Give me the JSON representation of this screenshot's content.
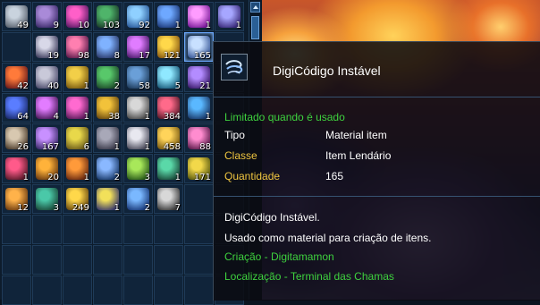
{
  "inventory": {
    "slots": [
      {
        "qty": "49",
        "c1": "#c9d3de",
        "c2": "#59626e"
      },
      {
        "qty": "9",
        "c1": "#a98ad8",
        "c2": "#3b2a6a"
      },
      {
        "qty": "10",
        "c1": "#ff5fc8",
        "c2": "#5a1a66"
      },
      {
        "qty": "103",
        "c1": "#4fb46a",
        "c2": "#1b3d2a"
      },
      {
        "qty": "92",
        "c1": "#8fd0ff",
        "c2": "#2a5a9a"
      },
      {
        "qty": "1",
        "c1": "#6ea8ff",
        "c2": "#1d3a7a"
      },
      {
        "qty": "1",
        "c1": "#ff9cff",
        "c2": "#7a1a9a"
      },
      {
        "qty": "1",
        "c1": "#a6a6ff",
        "c2": "#3a2a7a"
      },
      {
        "qty": "",
        "c1": "",
        "c2": ""
      },
      {
        "qty": "19",
        "c1": "#d8d8e8",
        "c2": "#3a3a5a"
      },
      {
        "qty": "98",
        "c1": "#ff7fb0",
        "c2": "#5a1a4a"
      },
      {
        "qty": "8",
        "c1": "#7fb2ff",
        "c2": "#2a3a6a"
      },
      {
        "qty": "17",
        "c1": "#e07cff",
        "c2": "#4a1a6a"
      },
      {
        "qty": "121",
        "c1": "#ffd84a",
        "c2": "#8a5a10"
      },
      {
        "qty": "165",
        "c1": "#c8e0ff",
        "c2": "#3a5a9a",
        "selected": true
      },
      {
        "qty": "",
        "c1": "",
        "c2": ""
      },
      {
        "qty": "42",
        "c1": "#ff7a3a",
        "c2": "#6a1a1a"
      },
      {
        "qty": "40",
        "c1": "#c9c9d9",
        "c2": "#4a4a6a"
      },
      {
        "qty": "1",
        "c1": "#f2cf48",
        "c2": "#7a5a10"
      },
      {
        "qty": "2",
        "c1": "#58c86a",
        "c2": "#1d4a2a"
      },
      {
        "qty": "58",
        "c1": "#6a9fd8",
        "c2": "#1d3a5a"
      },
      {
        "qty": "5",
        "c1": "#8fe8ff",
        "c2": "#1a5a7a"
      },
      {
        "qty": "21",
        "c1": "#b38cff",
        "c2": "#3a1a6a"
      },
      {
        "qty": "",
        "c1": "",
        "c2": ""
      },
      {
        "qty": "64",
        "c1": "#5a7dff",
        "c2": "#1a2a6a"
      },
      {
        "qty": "4",
        "c1": "#e27cff",
        "c2": "#4a1a5a"
      },
      {
        "qty": "1",
        "c1": "#ff6ad0",
        "c2": "#5a1a5a"
      },
      {
        "qty": "38",
        "c1": "#f2c23a",
        "c2": "#6a4a10"
      },
      {
        "qty": "1",
        "c1": "#d8d8d8",
        "c2": "#4a4a4a"
      },
      {
        "qty": "384",
        "c1": "#ff6a8a",
        "c2": "#5a1a2a"
      },
      {
        "qty": "1",
        "c1": "#5ab8ff",
        "c2": "#1a3a6a"
      },
      {
        "qty": "",
        "c1": "",
        "c2": ""
      },
      {
        "qty": "26",
        "c1": "#d8c8b0",
        "c2": "#4a3a2a"
      },
      {
        "qty": "167",
        "c1": "#c890ff",
        "c2": "#3a2a6a"
      },
      {
        "qty": "6",
        "c1": "#e8d84a",
        "c2": "#6a5a1a"
      },
      {
        "qty": "1",
        "c1": "#a8a8b8",
        "c2": "#3a3a4a"
      },
      {
        "qty": "1",
        "c1": "#e8e8f0",
        "c2": "#4a4a5a"
      },
      {
        "qty": "458",
        "c1": "#ffd45a",
        "c2": "#7a5a10"
      },
      {
        "qty": "88",
        "c1": "#ff8ccf",
        "c2": "#5a1a4a"
      },
      {
        "qty": "",
        "c1": "",
        "c2": ""
      },
      {
        "qty": "1",
        "c1": "#ff5a8a",
        "c2": "#5a1a2a"
      },
      {
        "qty": "20",
        "c1": "#ffb23a",
        "c2": "#6a3a10"
      },
      {
        "qty": "1",
        "c1": "#ff9a3a",
        "c2": "#6a2a10"
      },
      {
        "qty": "2",
        "c1": "#8ab8ff",
        "c2": "#1a3a6a"
      },
      {
        "qty": "3",
        "c1": "#a8e85a",
        "c2": "#2a5a1a"
      },
      {
        "qty": "1",
        "c1": "#5ad8a8",
        "c2": "#1a4a3a"
      },
      {
        "qty": "171",
        "c1": "#f2d84a",
        "c2": "#5a5a10"
      },
      {
        "qty": "",
        "c1": "",
        "c2": ""
      },
      {
        "qty": "12",
        "c1": "#ffb24a",
        "c2": "#6a3a10"
      },
      {
        "qty": "3",
        "c1": "#4ac8a8",
        "c2": "#1a4a3a"
      },
      {
        "qty": "249",
        "c1": "#ffd84a",
        "c2": "#6a4a10"
      },
      {
        "qty": "1",
        "c1": "#f2e05a",
        "c2": "#3a3a6a"
      },
      {
        "qty": "2",
        "c1": "#7ab8ff",
        "c2": "#1a3a7a"
      },
      {
        "qty": "7",
        "c1": "#d8d8d8",
        "c2": "#3a3a3a"
      },
      {
        "qty": "",
        "c1": "",
        "c2": ""
      },
      {
        "qty": "",
        "c1": "",
        "c2": ""
      },
      {
        "qty": "",
        "c1": "",
        "c2": ""
      },
      {
        "qty": "",
        "c1": "",
        "c2": ""
      },
      {
        "qty": "",
        "c1": "",
        "c2": ""
      },
      {
        "qty": "",
        "c1": "",
        "c2": ""
      },
      {
        "qty": "",
        "c1": "",
        "c2": ""
      },
      {
        "qty": "",
        "c1": "",
        "c2": ""
      },
      {
        "qty": "",
        "c1": "",
        "c2": ""
      },
      {
        "qty": "",
        "c1": "",
        "c2": ""
      },
      {
        "qty": "",
        "c1": "",
        "c2": ""
      },
      {
        "qty": "",
        "c1": "",
        "c2": ""
      },
      {
        "qty": "",
        "c1": "",
        "c2": ""
      },
      {
        "qty": "",
        "c1": "",
        "c2": ""
      },
      {
        "qty": "",
        "c1": "",
        "c2": ""
      },
      {
        "qty": "",
        "c1": "",
        "c2": ""
      },
      {
        "qty": "",
        "c1": "",
        "c2": ""
      },
      {
        "qty": "",
        "c1": "",
        "c2": ""
      },
      {
        "qty": "",
        "c1": "",
        "c2": ""
      },
      {
        "qty": "",
        "c1": "",
        "c2": ""
      },
      {
        "qty": "",
        "c1": "",
        "c2": ""
      },
      {
        "qty": "",
        "c1": "",
        "c2": ""
      },
      {
        "qty": "",
        "c1": "",
        "c2": ""
      },
      {
        "qty": "",
        "c1": "",
        "c2": ""
      },
      {
        "qty": "",
        "c1": "",
        "c2": ""
      },
      {
        "qty": "",
        "c1": "",
        "c2": ""
      }
    ]
  },
  "tooltip": {
    "icon": "wind-swirl-icon",
    "title": "DigiCódigo Instável",
    "restriction": "Limitado quando é usado",
    "fields": [
      {
        "label": "Tipo",
        "value": "Material item",
        "label_color": "white"
      },
      {
        "label": "Classe",
        "value": "Item Lendário",
        "label_color": "gold"
      },
      {
        "label": "Quantidade",
        "value": "165",
        "label_color": "gold"
      }
    ],
    "description_title": "DigiCódigo Instável.",
    "description": "Usado como material para criação de itens.",
    "creation": "Criação - Digitamamon",
    "location": "Localização - Terminal das Chamas"
  },
  "colors": {
    "green": "#3ed13e",
    "gold": "#f0c640",
    "panel_bg": "#0d1c2c"
  }
}
